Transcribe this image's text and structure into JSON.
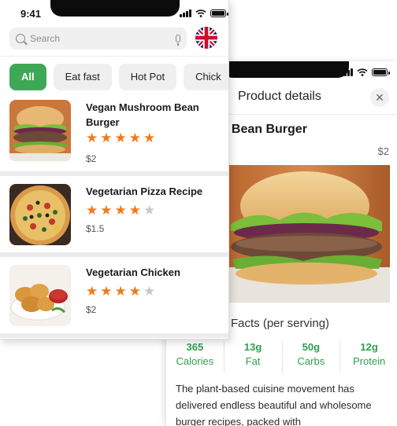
{
  "status_bar": {
    "time": "9:41"
  },
  "search": {
    "placeholder": "Search"
  },
  "categories": [
    {
      "label": "All",
      "active": true
    },
    {
      "label": "Eat fast",
      "active": false
    },
    {
      "label": "Hot Pot",
      "active": false
    },
    {
      "label": "Chick",
      "active": false
    }
  ],
  "products": [
    {
      "name": "Vegan Mushroom Bean Burger",
      "rating": 5,
      "price": "$2",
      "image": "burger-image"
    },
    {
      "name": "Vegetarian Pizza Recipe",
      "rating": 4,
      "price": "$1.5",
      "image": "pizza-image"
    },
    {
      "name": "Vegetarian Chicken",
      "rating": 4,
      "price": "$2",
      "image": "nuggets-image"
    }
  ],
  "detail": {
    "title": "Product details",
    "name": "ushroom Bean Burger",
    "price": "$2",
    "nutrition_title": "Facts (per serving)",
    "nutrition": [
      {
        "value": "365",
        "label": "Calories"
      },
      {
        "value": "13g",
        "label": "Fat"
      },
      {
        "value": "50g",
        "label": "Carbs"
      },
      {
        "value": "12g",
        "label": "Protein"
      }
    ],
    "description": "The plant-based cuisine movement has delivered endless beautiful and wholesome burger recipes, packed with"
  },
  "colors": {
    "accent_green": "#3fa857",
    "star_orange": "#f07a1a",
    "nutrition_green": "#2e9e4f"
  }
}
